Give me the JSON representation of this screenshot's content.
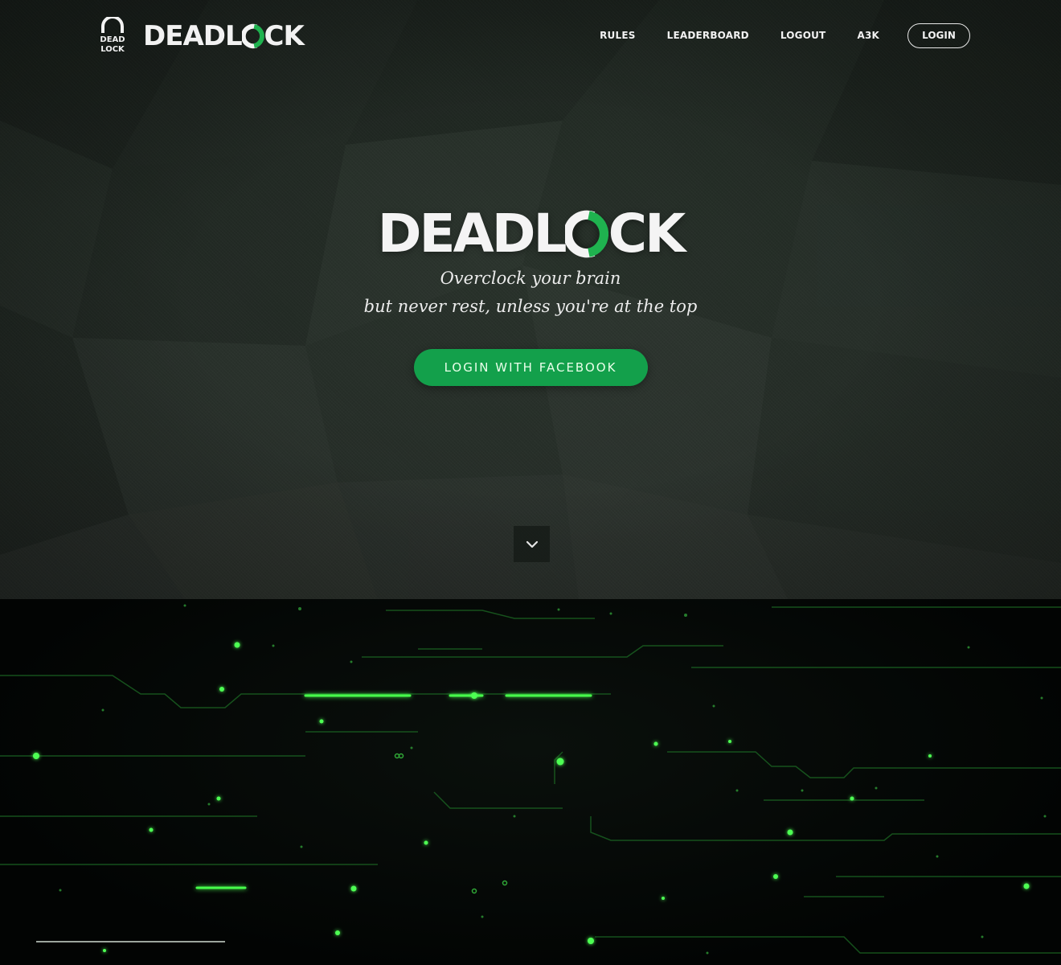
{
  "nav": {
    "brand": "DEADLOCK",
    "brand_badge_top": "DEAD",
    "brand_badge_bottom": "LOCK",
    "links": [
      "RULES",
      "LEADERBOARD",
      "LOGOUT",
      "A3K"
    ],
    "login_label": "LOGIN"
  },
  "hero": {
    "logo": "DEADLOCK",
    "tagline_line1": "Overclock your brain",
    "tagline_line2": "but never rest, unless you're at the top",
    "cta_label": "LOGIN WITH FACEBOOK",
    "scroll_icon": "chevron-down-icon"
  },
  "colors": {
    "accent": "#13a04b",
    "logo_green": "#1fb24f",
    "circuit_glow": "#3cff4a",
    "hero_bg": "#232b25",
    "circuit_bg": "#040705"
  }
}
